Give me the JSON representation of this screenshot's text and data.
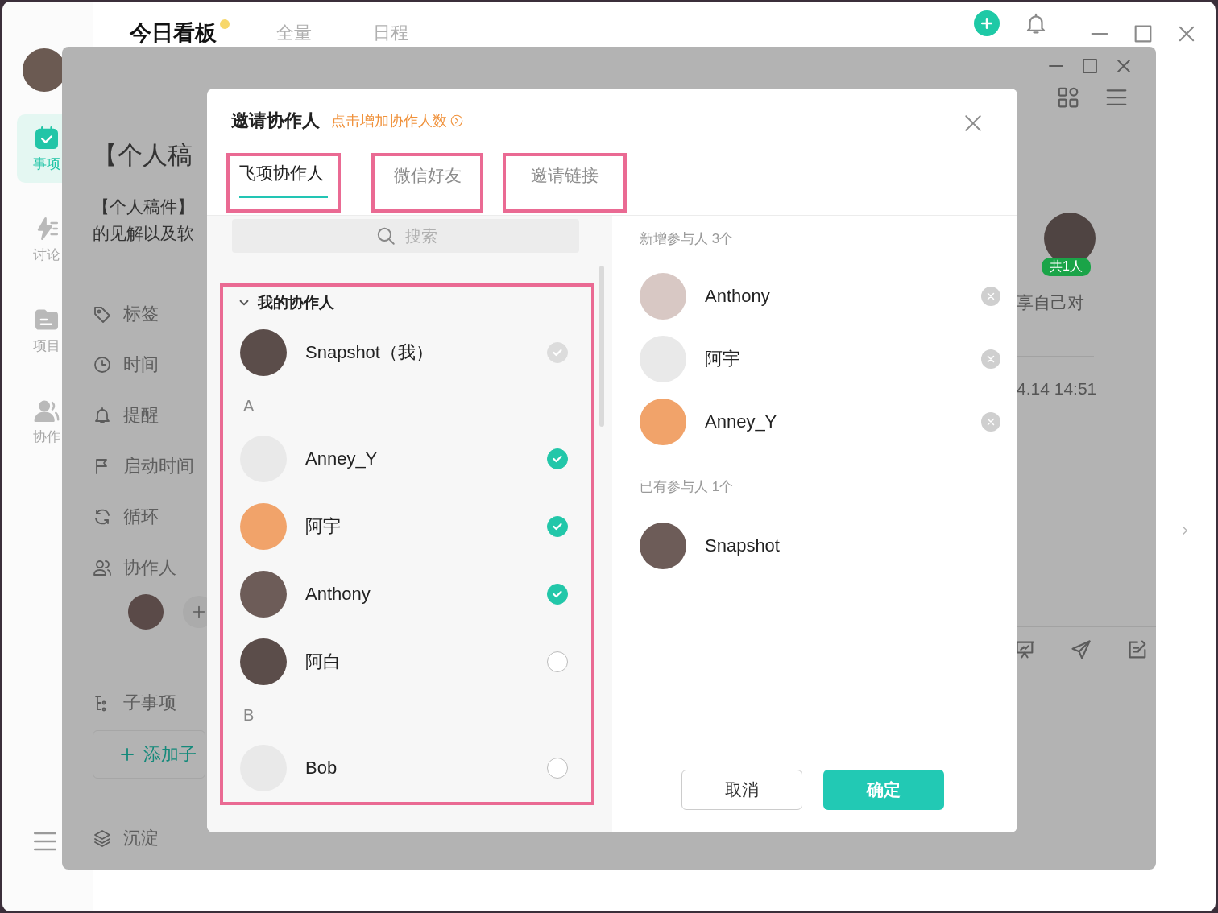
{
  "app": {
    "tabs": [
      {
        "label": "今日看板",
        "selected": true
      },
      {
        "label": "全量",
        "selected": false
      },
      {
        "label": "日程",
        "selected": false
      }
    ],
    "nav": [
      {
        "label": "事项",
        "selected": true
      },
      {
        "label": "讨论",
        "selected": false
      },
      {
        "label": "项目",
        "selected": false
      },
      {
        "label": "协作",
        "selected": false
      }
    ]
  },
  "task_window": {
    "title": "【个人稿",
    "description": [
      "【个人稿件】",
      "的见解以及软"
    ],
    "fields": [
      "标签",
      "时间",
      "提醒",
      "启动时间",
      "循环",
      "协作人"
    ],
    "subtasks": {
      "label": "子事项",
      "add_button": "添加子"
    },
    "archive": "沉淀",
    "participants_badge": "共1人",
    "comment_snippet": "享自己对",
    "timestamp": "4.14 14:51"
  },
  "dialog": {
    "title": "邀请协作人",
    "upgrade_link": "点击增加协作人数",
    "tabs": [
      {
        "label": "飞项协作人",
        "selected": true
      },
      {
        "label": "微信好友",
        "selected": false
      },
      {
        "label": "邀请链接",
        "selected": false
      }
    ],
    "search": {
      "placeholder": "搜索"
    },
    "contacts": [
      {
        "kind": "group",
        "label": "我的协作人",
        "expanded": true
      },
      {
        "kind": "person",
        "name": "Snapshot（我）",
        "checked": true,
        "disabled": true
      },
      {
        "kind": "letter",
        "label": "A"
      },
      {
        "kind": "person",
        "name": "Anney_Y",
        "checked": true,
        "disabled": false
      },
      {
        "kind": "person",
        "name": "阿宇",
        "checked": true,
        "disabled": false
      },
      {
        "kind": "person",
        "name": "Anthony",
        "checked": true,
        "disabled": false
      },
      {
        "kind": "person",
        "name": "阿白",
        "checked": false,
        "disabled": false
      },
      {
        "kind": "letter",
        "label": "B"
      },
      {
        "kind": "person",
        "name": "Bob",
        "checked": false,
        "disabled": false
      }
    ],
    "new_section": "新增参与人 3个",
    "new_participants": [
      "Anthony",
      "阿宇",
      "Anney_Y"
    ],
    "existing_section": "已有参与人 1个",
    "existing_participants": [
      "Snapshot"
    ],
    "buttons": {
      "cancel": "取消",
      "confirm": "确定"
    }
  }
}
